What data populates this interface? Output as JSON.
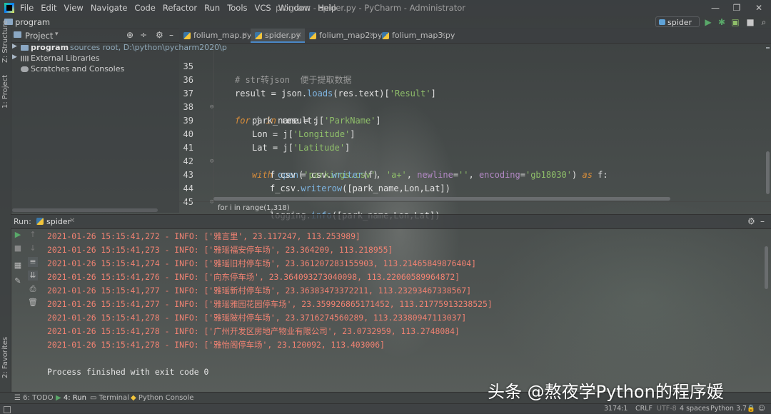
{
  "window": {
    "title": "program - spider.py - PyCharm - Administrator",
    "menu": [
      "File",
      "Edit",
      "View",
      "Navigate",
      "Code",
      "Refactor",
      "Run",
      "Tools",
      "VCS",
      "Window",
      "Help"
    ],
    "controls": {
      "minimize": "—",
      "restore": "❐",
      "close": "✕"
    }
  },
  "navbar": {
    "project": "program",
    "run_config": "spider"
  },
  "left_strip": {
    "structure": "Z: Structure",
    "project": "1: Project",
    "favorites": "2: Favorites"
  },
  "project_panel": {
    "title": "Project",
    "tree": [
      {
        "label": "program",
        "path": "sources root,  D:\\python\\pycharm2020\\p",
        "bold": true
      },
      {
        "label": "External Libraries"
      },
      {
        "label": "Scratches and Consoles"
      }
    ]
  },
  "editor": {
    "tabs": [
      {
        "label": "folium_map.py",
        "active": false
      },
      {
        "label": "spider.py",
        "active": true
      },
      {
        "label": "folium_map2.py",
        "active": false
      },
      {
        "label": "folium_map3.py",
        "active": false
      }
    ],
    "line_numbers": [
      "35",
      "36",
      "37",
      "38",
      "39",
      "40",
      "41",
      "42",
      "43",
      "44",
      "45"
    ],
    "code": {
      "l35": "# str转json  便于提取数据",
      "l36_a": "result = json.",
      "l36_fn": "loads",
      "l36_b": "(res.text)[",
      "l36_str": "'Result'",
      "l36_c": "]",
      "l37_kw": "for",
      "l37_a": " j ",
      "l37_kw2": "in",
      "l37_b": " result:",
      "l38_a": "park_name = j[",
      "l38_str": "'ParkName'",
      "l38_b": "]",
      "l39_a": "Lon = j[",
      "l39_str": "'Longitude'",
      "l39_b": "]",
      "l40_a": "Lat = j[",
      "l40_str": "'Latitude'",
      "l40_b": "]",
      "l41_kw": "with",
      "l41_fn": " open",
      "l41_a": "(",
      "l41_s1": "'parkings.csv'",
      "l41_b": ", ",
      "l41_s2": "'a+'",
      "l41_c": ", ",
      "l41_p1": "newline",
      "l41_d": "=",
      "l41_s3": "''",
      "l41_e": ", ",
      "l41_p2": "encoding",
      "l41_f": "=",
      "l41_s4": "'gb18030'",
      "l41_g": ") ",
      "l41_kw2": "as",
      "l41_h": " f:",
      "l42_a": "f_csv = csv.",
      "l42_fn": "writer",
      "l42_b": "(f)",
      "l43_a": "f_csv.",
      "l43_fn": "writerow",
      "l43_b": "([park_name,Lon,Lat])",
      "l44_a": "logging.",
      "l44_fn": "info",
      "l44_b": "([park_name,Lon,Lat])"
    },
    "breadcrumb": "for i in range(1,318)"
  },
  "run_panel": {
    "label": "Run:",
    "tab": "spider",
    "log": [
      "2021-01-26 15:15:41,272 - INFO: ['雅言里', 23.117247, 113.253989]",
      "2021-01-26 15:15:41,273 - INFO: ['雅瑶福安停车场', 23.364209, 113.218955]",
      "2021-01-26 15:15:41,274 - INFO: ['雅瑶旧村停车场', 23.361207283155903, 113.21465849876404]",
      "2021-01-26 15:15:41,276 - INFO: ['向东停车场', 23.364093273040098, 113.22060589964872]",
      "2021-01-26 15:15:41,277 - INFO: ['雅瑶新村停车场', 23.36383473372211, 113.23293467338567]",
      "2021-01-26 15:15:41,277 - INFO: ['雅瑶雅园花园停车场', 23.359926865171452, 113.21775913238525]",
      "2021-01-26 15:15:41,278 - INFO: ['雅瑶陂村停车场', 23.3716274560289, 113.23380947113037]",
      "2021-01-26 15:15:41,278 - INFO: ['广州开发区房地产物业有限公司', 23.0732959, 113.2748084]",
      "2021-01-26 15:15:41,278 - INFO: ['雅怡阁停车场', 23.120092, 113.403006]"
    ],
    "exit": "Process finished with exit code 0"
  },
  "bottom_tools": {
    "todo": "6: TODO",
    "run": "4: Run",
    "terminal": "Terminal",
    "python_console": "Python Console"
  },
  "status": {
    "position": "3174:1",
    "line_sep": "CRLF",
    "encoding": "UTF-8",
    "indent": "4 spaces",
    "interpreter": "Python 3.7"
  },
  "watermark": "头条 @熬夜学Python的程序媛",
  "colors": {
    "log_text": "#f08272",
    "keyword": "#d98d3a",
    "string": "#8fbf6a",
    "function": "#7fb6e3",
    "accent": "#4a88c7",
    "run_green": "#59a869"
  }
}
